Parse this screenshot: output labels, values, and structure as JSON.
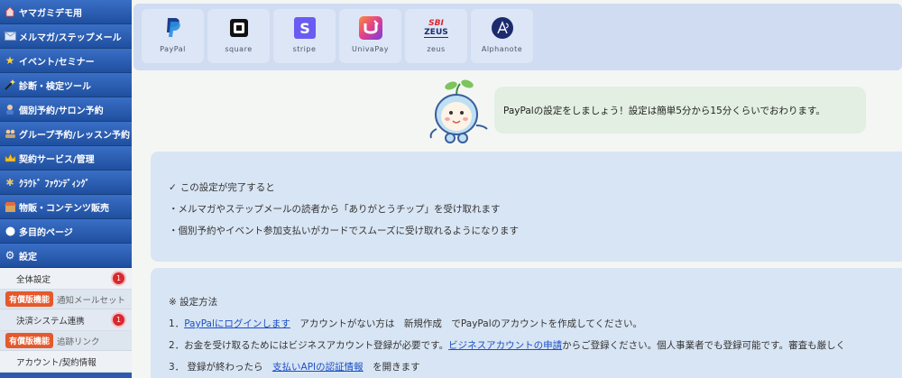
{
  "sidebar": {
    "items": [
      {
        "label": "ヤマガミデモ用",
        "icon": "home-icon"
      },
      {
        "label": "メルマガ/ステップメール",
        "icon": "mail-icon"
      },
      {
        "label": "イベント/セミナー",
        "icon": "star-icon"
      },
      {
        "label": "診断・検定ツール",
        "icon": "wand-icon"
      },
      {
        "label": "個別予約/サロン予約",
        "icon": "person-icon"
      },
      {
        "label": "グループ予約/レッスン予約",
        "icon": "group-icon"
      },
      {
        "label": "契約サービス/管理",
        "icon": "crown-icon"
      },
      {
        "label": "ｸﾗｳﾄﾞ ﾌｧｳﾝﾃﾞｨﾝｸﾞ",
        "icon": "gear-icon"
      },
      {
        "label": "物販・コンテンツ販売",
        "icon": "shop-icon"
      },
      {
        "label": "多目的ページ",
        "icon": "dot-icon"
      },
      {
        "label": "設定",
        "icon": "settings-icon"
      }
    ],
    "settings_sub": {
      "general": {
        "label": "全体設定",
        "badge": "1"
      },
      "feature1": {
        "tag": "有償版機能",
        "label": "通知メールセット"
      },
      "payment": {
        "label": "決済システム連携",
        "badge": "1"
      },
      "feature2": {
        "tag": "有償版機能",
        "label": "追跡リンク"
      },
      "account": {
        "label": "アカウント/契約情報"
      }
    }
  },
  "providers": [
    {
      "name": "PayPal",
      "icon": "paypal-logo"
    },
    {
      "name": "square",
      "icon": "square-logo"
    },
    {
      "name": "stripe",
      "icon": "stripe-logo"
    },
    {
      "name": "UnivaPay",
      "icon": "univapay-logo"
    },
    {
      "name": "zeus",
      "icon": "zeus-logo",
      "logo_text_top": "SBI",
      "logo_text_bottom": "ZEUS"
    },
    {
      "name": "Alphanote",
      "icon": "alphanote-logo"
    }
  ],
  "bubble": {
    "text": "PayPalの設定をしましょう！設定は簡単5分から15分くらいでおわります。"
  },
  "intro": {
    "check_mark": "✓",
    "heading": "この設定が完了すると",
    "bullet1": "・メルマガやステップメールの読者から「ありがとうチップ」を受け取れます",
    "bullet2": "・個別予約やイベント参加支払いがカードでスムーズに受け取れるようになります"
  },
  "steps": {
    "heading": "※  設定方法",
    "s1_prefix": "1．",
    "s1_link": "PayPalにログインします",
    "s1_rest": "　アカウントがない方は　新規作成　でPayPalのアカウントを作成してください。",
    "s2_prefix": "2．お金を受け取るためにはビジネスアカウント登録が必要です。",
    "s2_link": "ビジネスアカウントの申請",
    "s2_rest": "からご登録ください。個人事業者でも登録可能です。審査も厳しく",
    "s3_prefix": "3．  登録が終わったら　",
    "s3_link": "支払いAPIの認証情報",
    "s3_rest": "　を開きます"
  },
  "colors": {
    "sidebar": "#2b5ab0",
    "paid_tag": "#e5592c",
    "badge": "#d9282f",
    "link": "#1b4fc4",
    "panel": "#d8e5f4",
    "bubble": "#e2efe2"
  }
}
